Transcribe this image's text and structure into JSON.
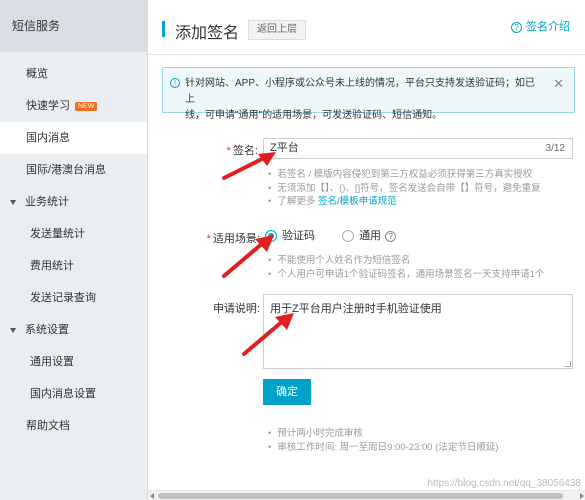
{
  "sidebar": {
    "header": "短信服务",
    "items": [
      {
        "label": "概览"
      },
      {
        "label": "快速学习",
        "badge": "NEW"
      },
      {
        "label": "国内消息"
      },
      {
        "label": "国际/港澳台消息"
      }
    ],
    "group_business": "业务统计",
    "business_items": [
      "发送量统计",
      "费用统计",
      "发送记录查询"
    ],
    "group_system": "系统设置",
    "system_items": [
      "通用设置",
      "国内消息设置"
    ],
    "help_docs": "帮助文档"
  },
  "header": {
    "title": "添加签名",
    "back_label": "返回上层",
    "help_label": "签名介绍",
    "help_icon": "?"
  },
  "notice": {
    "icon": "i",
    "line1": "针对网站、APP、小程序或公众号未上线的情况，平台只支持发送验证码；如已上",
    "line2": "线，可申请\"通用\"的适用场景，可发送验证码、短信通知。",
    "close": "✕"
  },
  "form": {
    "required_mark": "*",
    "sign_label": "签名:",
    "sign_value": "Z平台",
    "sign_count": "3/12",
    "sign_tips": [
      "若签名 / 模版内容侵犯到第三方权益必须获得第三方真实授权",
      "无须添加【】、()、[]符号，签名发送会自带【】符号，避免重复"
    ],
    "sign_tip_more_prefix": "了解更多 ",
    "sign_tip_link": "签名/模板申请规范",
    "scene_label": "适用场景:",
    "scene_options": [
      "验证码",
      "通用"
    ],
    "scene_selected": "验证码",
    "scene_help_icon": "?",
    "scene_tips": [
      "不能使用个人姓名作为短信签名",
      "个人用户可申请1个验证码签名，通用场景签名一天支持申请1个"
    ],
    "desc_label": "申请说明:",
    "desc_value": "用于Z平台用户注册时手机验证使用",
    "submit": "确定",
    "footer_tips": [
      "预计两小时完成审核",
      "审核工作时间: 周一至周日9:00-23:00 (法定节日顺延)"
    ]
  },
  "watermark": "https://blog.csdn.net/qq_38056438",
  "colors": {
    "accent": "#00a2ca",
    "annotation_arrow": "#e02020",
    "sidebar_bg": "#eaedf1"
  }
}
